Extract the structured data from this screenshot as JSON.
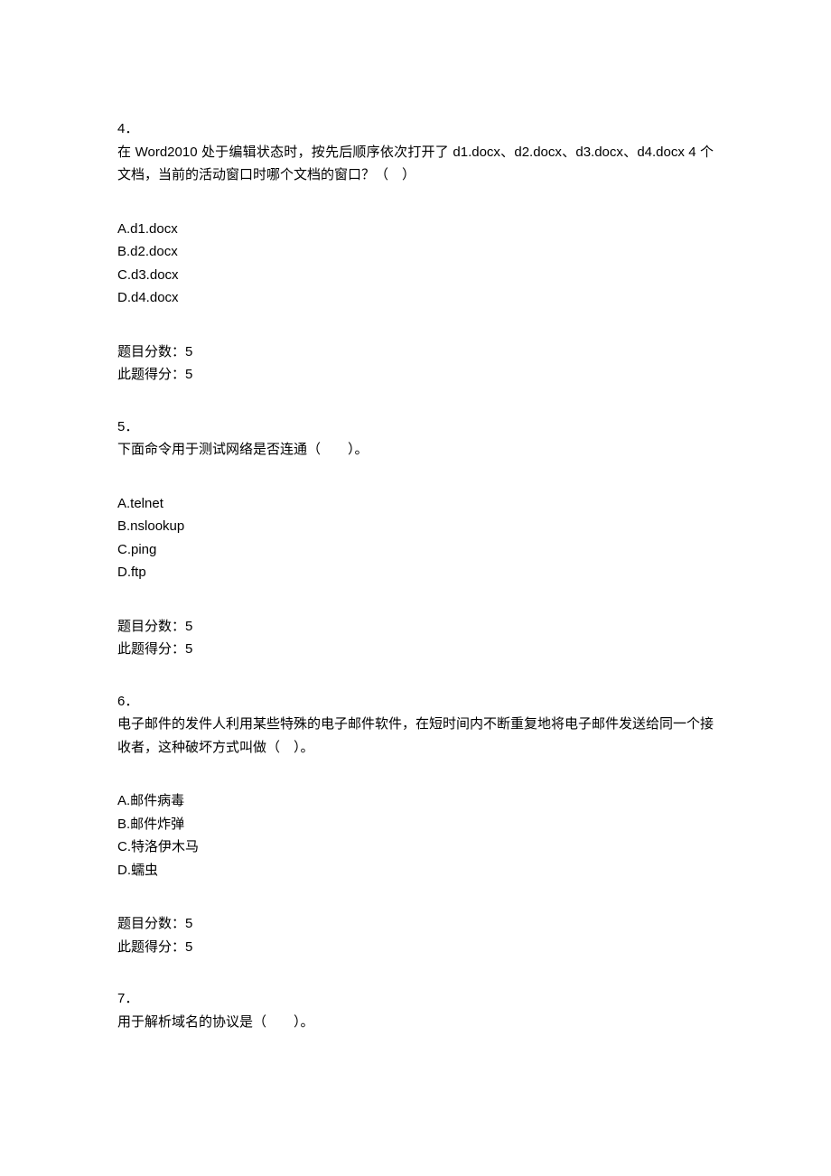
{
  "questions": [
    {
      "number": "4．",
      "stem": "在 Word2010 处于编辑状态时，按先后顺序依次打开了 d1.docx、d2.docx、d3.docx、d4.docx 4 个文档，当前的活动窗口时哪个文档的窗口？（　）",
      "options": {
        "A": "A.d1.docx",
        "B": "B.d2.docx",
        "C": "C.d3.docx",
        "D": "D.d4.docx"
      },
      "score_label": "题目分数：5",
      "got_label": "此题得分：5"
    },
    {
      "number": "5．",
      "stem": "下面命令用于测试网络是否连通（　　）。",
      "options": {
        "A": "A.telnet",
        "B": "B.nslookup",
        "C": "C.ping",
        "D": "D.ftp"
      },
      "score_label": "题目分数：5",
      "got_label": "此题得分：5"
    },
    {
      "number": "6．",
      "stem": "电子邮件的发件人利用某些特殊的电子邮件软件，在短时间内不断重复地将电子邮件发送给同一个接收者，这种破坏方式叫做（　）。",
      "options": {
        "A": "A.邮件病毒",
        "B": "B.邮件炸弹",
        "C": "C.特洛伊木马",
        "D": "D.蠕虫"
      },
      "score_label": "题目分数：5",
      "got_label": "此题得分：5"
    },
    {
      "number": "7．",
      "stem": "用于解析域名的协议是（　　）。",
      "options": null,
      "score_label": null,
      "got_label": null
    }
  ]
}
